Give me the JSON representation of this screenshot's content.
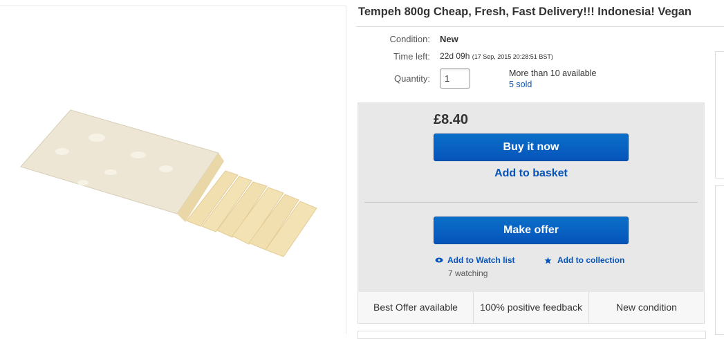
{
  "listing": {
    "title": "Tempeh 800g Cheap, Fresh, Fast Delivery!!! Indonesia! Vegan",
    "condition_label": "Condition:",
    "condition_value": "New",
    "time_left_label": "Time left:",
    "time_left_value": "22d 09h",
    "time_left_detail": "(17 Sep, 2015   20:28:51 BST)",
    "quantity_label": "Quantity:",
    "quantity_value": "1",
    "availability": "More than 10 available",
    "sold": "5 sold"
  },
  "purchase": {
    "price": "£8.40",
    "buy_now_label": "Buy it now",
    "add_to_basket_label": "Add to basket",
    "make_offer_label": "Make offer",
    "watch_list_label": "Add to Watch list",
    "watching_count": "7 watching",
    "collection_label": "Add to collection"
  },
  "features": [
    "Best Offer available",
    "100% positive feedback",
    "New condition"
  ],
  "colors": {
    "link": "#0654ba",
    "button": "#0654ba",
    "panel_bg": "#e8e8e8"
  },
  "icons": {
    "watch": "eye-icon",
    "collection": "star-icon"
  }
}
